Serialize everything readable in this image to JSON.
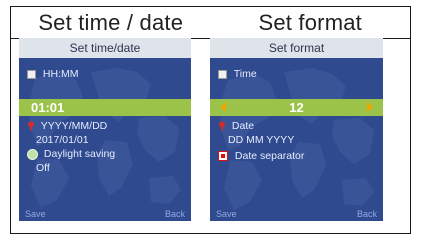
{
  "header": {
    "left_title": "Set time / date",
    "right_title": "Set format"
  },
  "left_screen": {
    "title": "Set time/date",
    "rows": {
      "time_label": "HH:MM",
      "time_value": "01:01",
      "date_label": "YYYY/MM/DD",
      "date_value": "2017/01/01",
      "dst_label": "Daylight saving",
      "dst_value": "Off"
    },
    "softkeys": {
      "left": "Save",
      "right": "Back"
    }
  },
  "right_screen": {
    "title": "Set format",
    "rows": {
      "time_label": "Time",
      "time_value": "12",
      "date_label": "Date",
      "date_value": "DD MM YYYY",
      "separator_label": "Date separator"
    },
    "softkeys": {
      "left": "Save",
      "right": "Back"
    }
  },
  "colors": {
    "screen_bg": "#2f4a8f",
    "highlight": "#9bc34a",
    "title_bar": "#dfe3ea",
    "arrow": "#f2a600",
    "text": "#e6ecff"
  },
  "icons": {
    "time_row": "square-icon",
    "date_row": "pin-icon",
    "dst_row": "circle-icon",
    "separator_row": "red-checkbox-icon",
    "left_arrow": "triangle-left-icon",
    "right_arrow": "triangle-right-icon"
  }
}
